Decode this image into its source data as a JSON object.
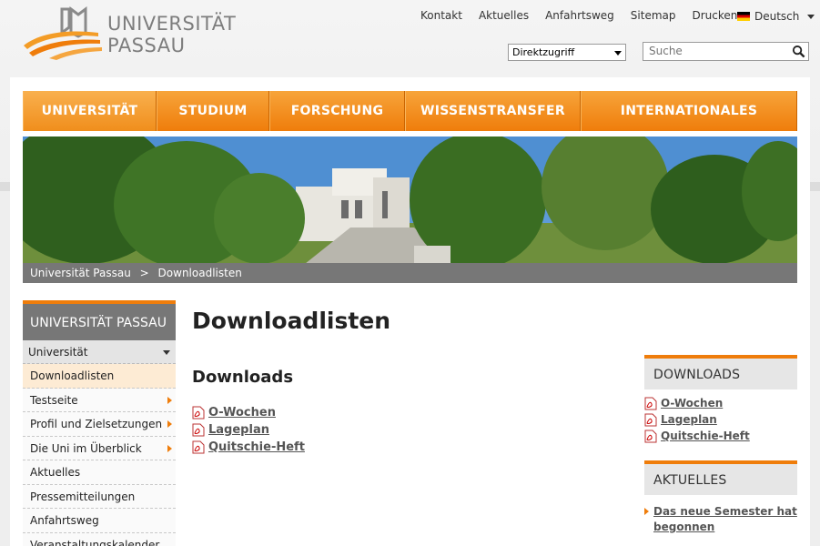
{
  "brand": {
    "line1": "UNIVERSITÄT",
    "line2": "PASSAU",
    "colors": {
      "orange": "#ef7d0b",
      "gray": "#777777"
    }
  },
  "topnav": {
    "items": [
      "Kontakt",
      "Aktuelles",
      "Anfahrtsweg",
      "Sitemap",
      "Drucken"
    ],
    "language": "Deutsch"
  },
  "direktzugriff": {
    "value": "Direktzugriff"
  },
  "search": {
    "placeholder": "Suche"
  },
  "mainnav": {
    "items": [
      "UNIVERSITÄT",
      "STUDIUM",
      "FORSCHUNG",
      "WISSENSTRANSFER",
      "INTERNATIONALES"
    ]
  },
  "breadcrumb": {
    "root": "Universität Passau",
    "separator": ">",
    "current": "Downloadlisten"
  },
  "leftnav": {
    "heading": "UNIVERSITÄT PASSAU",
    "section": "Universität",
    "items": [
      "Downloadlisten",
      "Testseite",
      "Profil und Zielsetzungen",
      "Die Uni im Überblick",
      "Aktuelles",
      "Pressemitteilungen",
      "Anfahrtsweg",
      "Veranstaltungskalender"
    ]
  },
  "content": {
    "title": "Downloadlisten",
    "section": "Downloads",
    "files": [
      "O-Wochen",
      "Lageplan",
      "Quitschie-Heft"
    ]
  },
  "sidebar": {
    "downloads_heading": "DOWNLOADS",
    "downloads": [
      "O-Wochen",
      "Lageplan",
      "Quitschie-Heft"
    ],
    "news_heading": "AKTUELLES",
    "news": [
      "Das neue Semester hat begonnen"
    ]
  }
}
